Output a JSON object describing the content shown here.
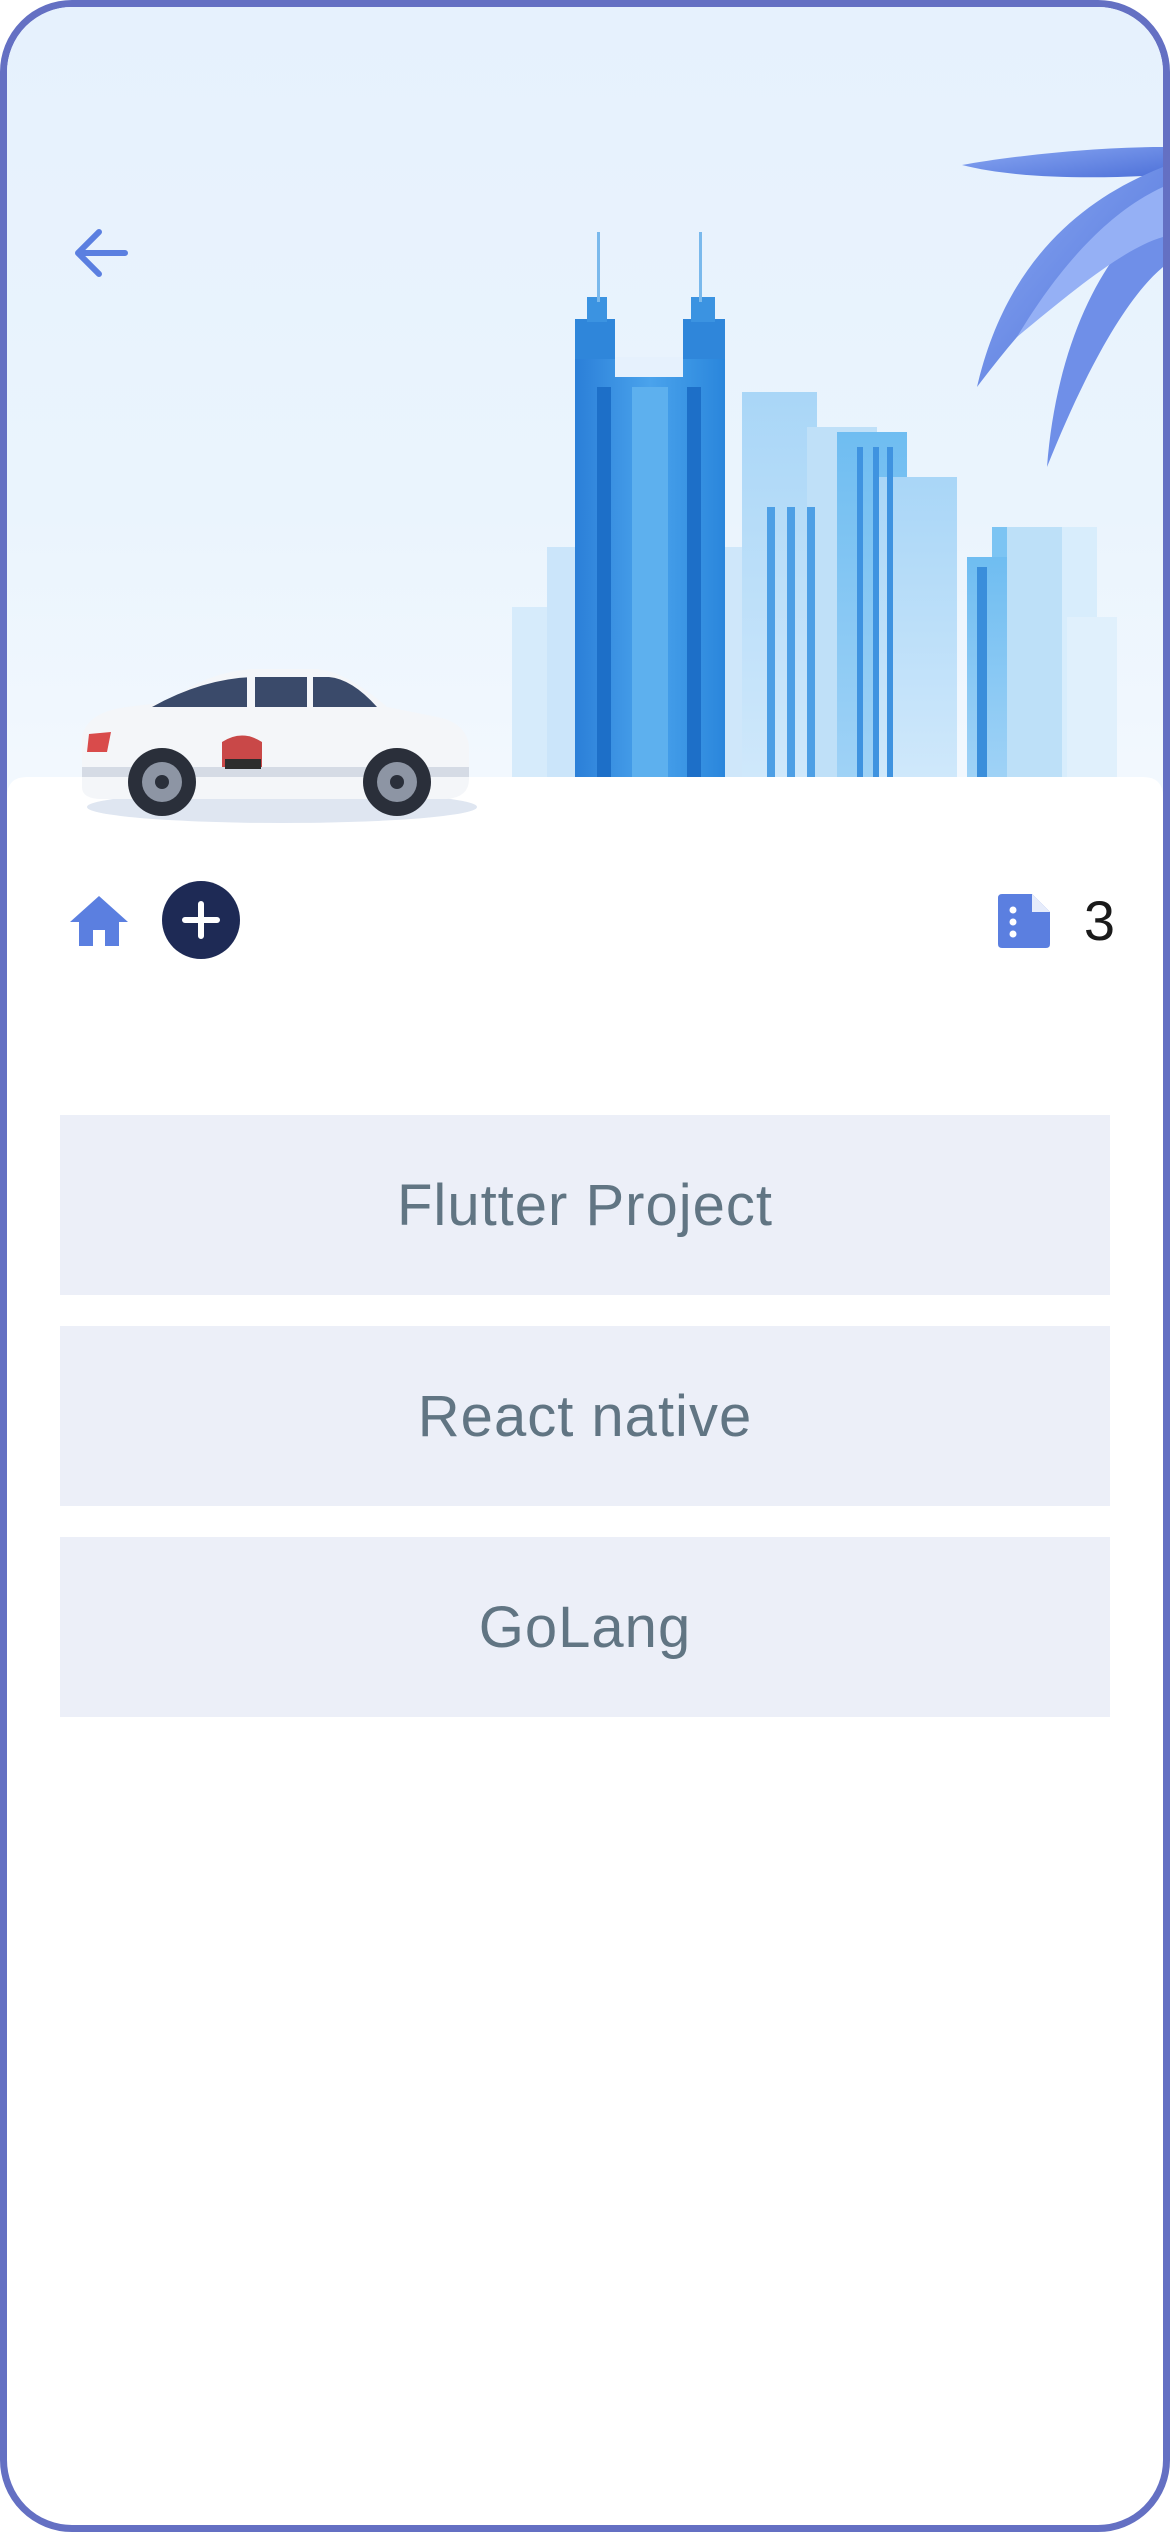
{
  "header": {
    "back_icon": "arrow-left-icon",
    "illustration": "city-skyline-with-car"
  },
  "toolbar": {
    "home_icon": "home-icon",
    "add_icon": "plus-circle-icon",
    "count_icon": "document-icon",
    "count": "3"
  },
  "projects": [
    {
      "label": "Flutter Project"
    },
    {
      "label": "React native"
    },
    {
      "label": "GoLang"
    }
  ],
  "colors": {
    "frame": "#6470c3",
    "accent": "#5b7fe0",
    "add_button": "#1e2a55",
    "item_background": "#eceff8",
    "item_text": "#617583"
  }
}
